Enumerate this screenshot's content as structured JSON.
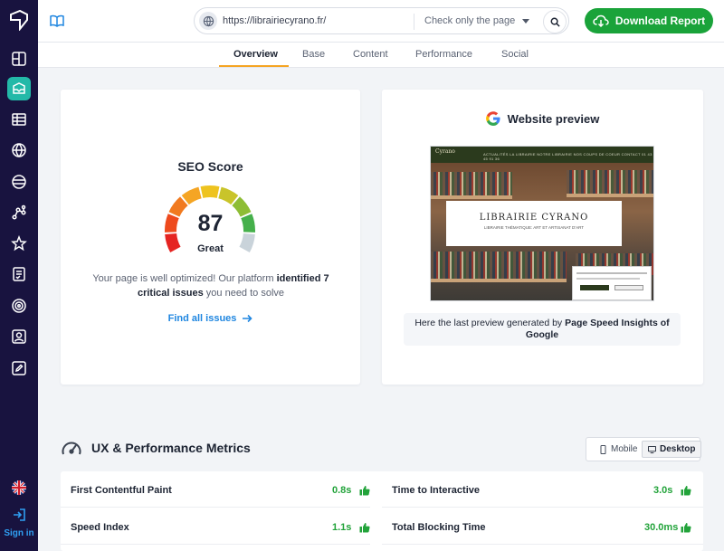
{
  "header": {
    "url_value": "https://librairiecyrano.fr/",
    "check_mode": "Check only the page",
    "download_label": "Download Report"
  },
  "tabs": [
    {
      "label": "Overview",
      "active": true
    },
    {
      "label": "Base",
      "active": false
    },
    {
      "label": "Content",
      "active": false
    },
    {
      "label": "Performance",
      "active": false
    },
    {
      "label": "Social",
      "active": false
    }
  ],
  "sidebar": {
    "icons": [
      "layout-icon",
      "inbox-icon",
      "table-icon",
      "globe-icon",
      "network-icon",
      "graph-icon",
      "star-icon",
      "checklist-icon",
      "target-icon",
      "user-icon",
      "edit-icon"
    ],
    "signin_label": "Sign in"
  },
  "seo": {
    "title": "SEO Score",
    "score": "87",
    "grade": "Great",
    "score_fraction": 0.87,
    "message_pre": "Your page is well optimized! Our platform ",
    "message_bold": "identified 7 critical issues",
    "message_post": " you need to solve",
    "find_label": "Find all issues"
  },
  "preview": {
    "title": "Website preview",
    "shot_logo": "Cyrano",
    "shot_nav": "ACTUALITÉS  LA LIBRAIRIE  NOTRE LIBRAIRIE  NOS COUPS DE COEUR  CONTACT  01 43 45 91 36",
    "shot_heading": "LIBRAIRIE CYRANO",
    "shot_subheading": "LIBRAIRIE THÉMATIQUE: ART ET ARTISANAT D'ART",
    "caption_pre": "Here the last preview generated by ",
    "caption_bold": "Page Speed Insights of Google"
  },
  "metrics": {
    "title": "UX & Performance Metrics",
    "mobile_label": "Mobile",
    "desktop_label": "Desktop",
    "items": [
      {
        "name": "First Contentful Paint",
        "value": "0.8s"
      },
      {
        "name": "Time to Interactive",
        "value": "3.0s"
      },
      {
        "name": "Speed Index",
        "value": "1.1s"
      },
      {
        "name": "Total Blocking Time",
        "value": "30.0ms"
      }
    ]
  },
  "colors": {
    "accent": "#f5a524",
    "sidebar": "#18133f",
    "primary_button": "#1aa33a",
    "link": "#1f86e0",
    "good": "#22a33a"
  }
}
